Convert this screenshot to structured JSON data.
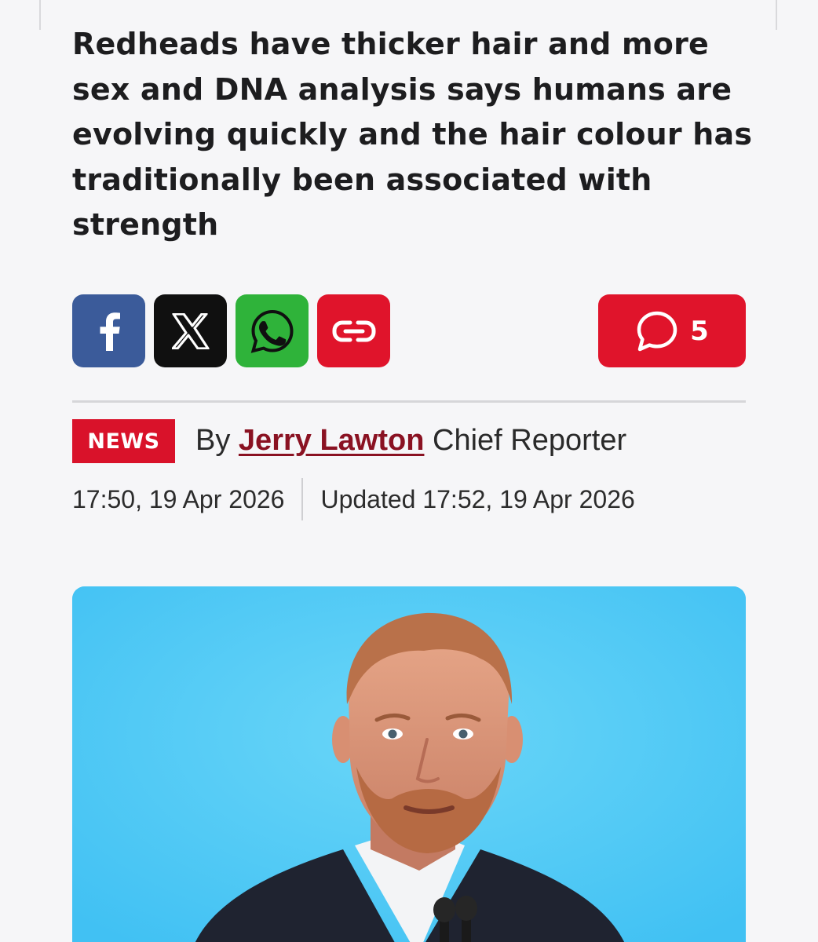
{
  "article": {
    "headline": "Redheads have thicker hair and more sex and DNA analysis says humans are evolving quickly and the hair colour has traditionally been associated with strength"
  },
  "share": {
    "buttons": [
      {
        "icon": "facebook-icon",
        "color": "#3b5b9a"
      },
      {
        "icon": "x-icon",
        "color": "#101010"
      },
      {
        "icon": "whatsapp-icon",
        "color": "#2fb33a"
      },
      {
        "icon": "link-icon",
        "color": "#e0142b"
      }
    ],
    "comments": {
      "icon": "comment-icon",
      "count": "5",
      "color": "#e0142b"
    }
  },
  "byline": {
    "section_badge": "NEWS",
    "by": "By",
    "author": "Jerry Lawton",
    "role": "Chief Reporter"
  },
  "timestamps": {
    "published": "17:50, 19 Apr 2026",
    "updated": "Updated 17:52, 19 Apr 2026"
  },
  "hero_image": {
    "subject": "man-with-red-beard-at-podium",
    "background_color": "#4cc6f5"
  }
}
